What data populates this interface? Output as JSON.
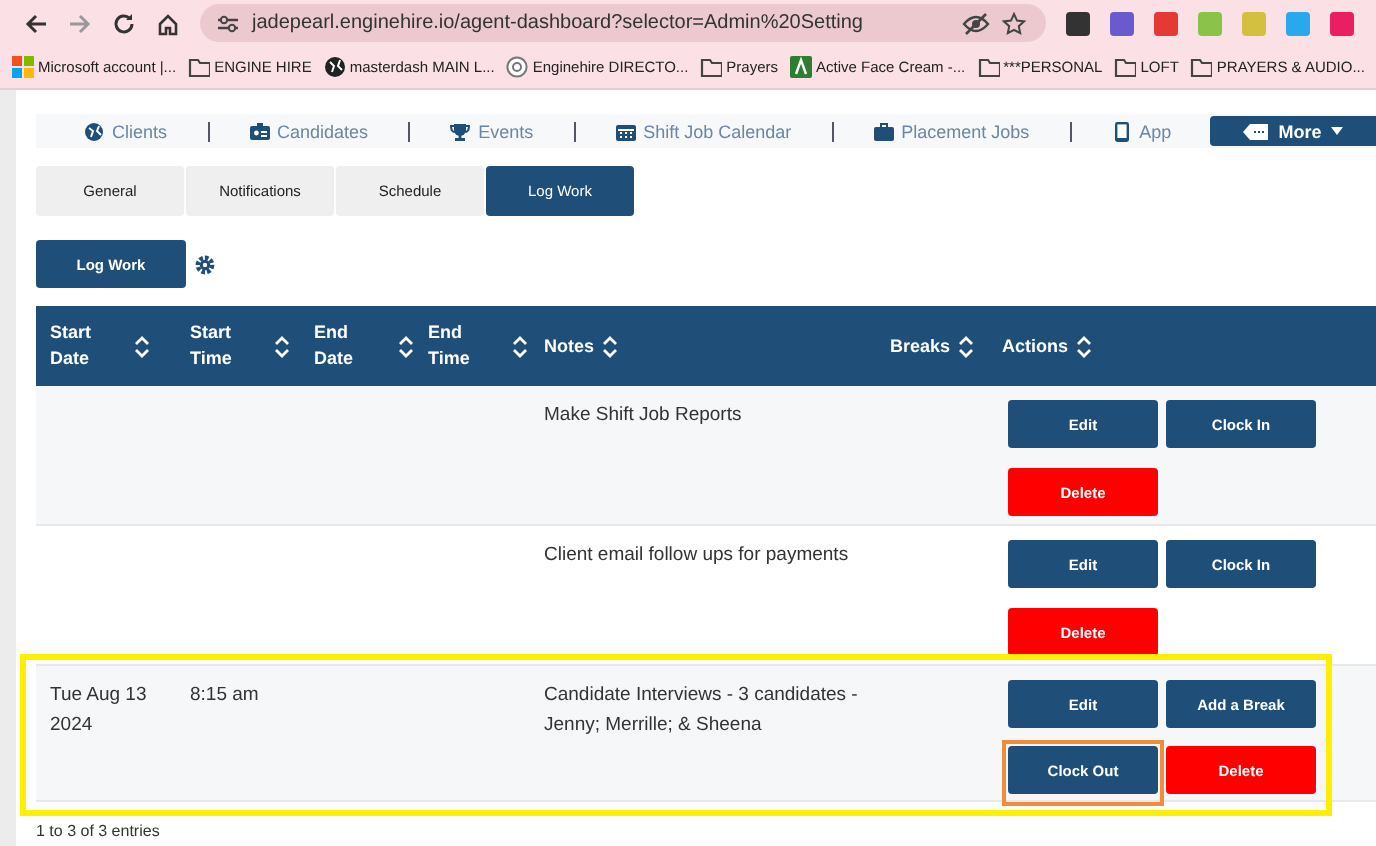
{
  "browser": {
    "url": "jadepearl.enginehire.io/agent-dashboard?selector=Admin%20Setting",
    "bookmarks": [
      {
        "kind": "tiles",
        "label": "Microsoft account |..."
      },
      {
        "kind": "folder",
        "label": "ENGINE HIRE"
      },
      {
        "kind": "globe",
        "label": "masterdash MAIN L..."
      },
      {
        "kind": "site",
        "label": "Enginehire DIRECTO..."
      },
      {
        "kind": "folder",
        "label": "Prayers"
      },
      {
        "kind": "app",
        "label": "Active Face Cream -..."
      },
      {
        "kind": "folder",
        "label": "***PERSONAL"
      },
      {
        "kind": "folder",
        "label": "LOFT"
      },
      {
        "kind": "folder",
        "label": "PRAYERS & AUDIO..."
      }
    ]
  },
  "nav": [
    {
      "kind": "globe",
      "label": "Clients"
    },
    {
      "kind": "card",
      "label": "Candidates"
    },
    {
      "kind": "trophy",
      "label": "Events"
    },
    {
      "kind": "calendar",
      "label": "Shift Job Calendar"
    },
    {
      "kind": "briefcase",
      "label": "Placement Jobs"
    },
    {
      "kind": "phone",
      "label": "App"
    }
  ],
  "more": "More",
  "tabs": [
    {
      "label": "General",
      "selected": false
    },
    {
      "label": "Notifications",
      "selected": false
    },
    {
      "label": "Schedule",
      "selected": false
    },
    {
      "label": "Log Work",
      "selected": true
    }
  ],
  "log_work_button": "Log Work",
  "table": {
    "columns": [
      {
        "label": "Start Date"
      },
      {
        "label": "Start Time"
      },
      {
        "label": "End Date"
      },
      {
        "label": "End Time"
      },
      {
        "label": "Notes"
      },
      {
        "label": "Breaks"
      },
      {
        "label": "Actions"
      }
    ],
    "rows": [
      {
        "cells": [
          "",
          "",
          "",
          "",
          "Make Shift Job Reports",
          ""
        ],
        "highlighted": false,
        "actions": [
          {
            "kind": "primary",
            "label": "Edit",
            "highlighted": false
          },
          {
            "kind": "primary",
            "label": "Clock In",
            "highlighted": false
          },
          {
            "kind": "danger",
            "label": "Delete",
            "highlighted": false
          }
        ]
      },
      {
        "cells": [
          "",
          "",
          "",
          "",
          "Client email follow ups for payments",
          ""
        ],
        "highlighted": false,
        "actions": [
          {
            "kind": "primary",
            "label": "Edit",
            "highlighted": false
          },
          {
            "kind": "primary",
            "label": "Clock In",
            "highlighted": false
          },
          {
            "kind": "danger",
            "label": "Delete",
            "highlighted": false
          }
        ]
      },
      {
        "cells": [
          "Tue Aug 13 2024",
          "8:15 am",
          "",
          "",
          "Candidate Interviews - 3 candidates - Jenny; Merrille; & Sheena",
          ""
        ],
        "highlighted": true,
        "actions": [
          {
            "kind": "primary",
            "label": "Edit",
            "highlighted": false
          },
          {
            "kind": "primary",
            "label": "Add a Break",
            "highlighted": false
          },
          {
            "kind": "primary",
            "label": "Clock Out",
            "highlighted": true
          },
          {
            "kind": "danger",
            "label": "Delete",
            "highlighted": false
          }
        ]
      }
    ]
  },
  "footer": "1 to 3 of 3 entries"
}
